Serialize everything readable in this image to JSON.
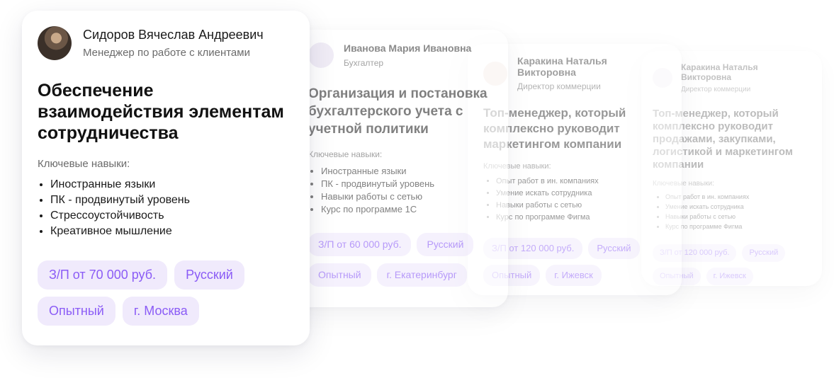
{
  "cards": [
    {
      "name": "Сидоров Вячеслав Андреевич",
      "role": "Менеджер по работе с клиентами",
      "title": "Обеспечение взаимодействия элементам сотрудничества",
      "skills_label": "Ключевые навыки:",
      "skills": [
        "Иностранные языки",
        "ПК - продвинутый уровень",
        "Стрессоустойчивость",
        "Креативное мышление"
      ],
      "tags": [
        "З/П от 70 000 руб.",
        "Русский",
        "Опытный",
        "г. Москва"
      ]
    },
    {
      "name": "Иванова Мария Ивановна",
      "role": "Бухгалтер",
      "title": "Организация и постановка бухгалтерского учета с учетной политики",
      "skills_label": "Ключевые навыки:",
      "skills": [
        "Иностранные языки",
        "ПК - продвинутый уровень",
        "Навыки работы с сетью",
        "Курс по программе 1С"
      ],
      "tags": [
        "З/П от 60 000 руб.",
        "Русский",
        "Опытный",
        "г. Екатеринбург"
      ]
    },
    {
      "name": "Каракина Наталья Викторовна",
      "role": "Директор коммерции",
      "title": "Топ-менеджер, который комплексно руководит маркетингом компании",
      "skills_label": "Ключевые навыки:",
      "skills": [
        "Опыт работ в ин. компаниях",
        "Умение искать сотрудника",
        "Навыки работы с сетью",
        "Курс по программе Фигма"
      ],
      "tags": [
        "З/П от 120 000 руб.",
        "Русский",
        "Опытный",
        "г. Ижевск"
      ]
    },
    {
      "name": "Каракина Наталья Викторовна",
      "role": "Директор коммерции",
      "title": "Топ-менеджер, который комплексно руководит продажами, закупками, логистикой и маркетингом компании",
      "skills_label": "Ключевые навыки:",
      "skills": [
        "Опыт работ в ин. компаниях",
        "Умение искать сотрудника",
        "Навыки работы с сетью",
        "Курс по программе Фигма"
      ],
      "tags": [
        "З/П от 120 000 руб.",
        "Русский",
        "Опытный",
        "г. Ижевск"
      ]
    }
  ],
  "colors": {
    "tag_bg": "#f0eafc",
    "tag_text": "#8b5cf6"
  },
  "icons": {
    "avatar": "user-photo-icon"
  }
}
